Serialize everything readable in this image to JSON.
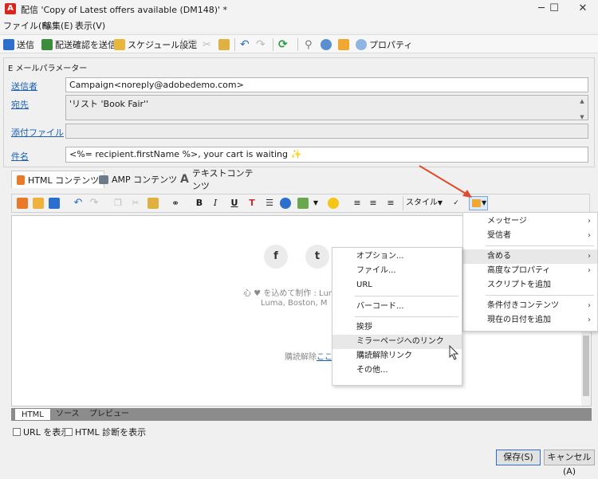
{
  "window": {
    "icon": "A",
    "title": "配信 'Copy of Latest offers available (DM148)' *",
    "controls": [
      "─",
      "☐",
      "✕"
    ]
  },
  "menubar": [
    "ファイル(F)",
    "編集(E)",
    "表示(V)"
  ],
  "toolbar": {
    "send": "送信",
    "send_proof": "配送確認を送信",
    "schedule": "スケジュール設定",
    "properties": "プロパティ"
  },
  "email_params": {
    "section_title": "E メールパラメーター",
    "from_label": "送信者",
    "from_value": "Campaign<noreply@adobedemo.com>",
    "to_label": "宛先",
    "to_value": "'リスト 'Book Fair''",
    "attachment_label": "添付ファイル",
    "attachment_value": "",
    "subject_label": "件名",
    "subject_value": "<%= recipient.firstName %>, your cart is waiting ✨"
  },
  "content_tabs": [
    "HTML コンテンツ",
    "AMP コンテンツ",
    "テキストコンテンツ"
  ],
  "editor_toolbar": {
    "bold": "B",
    "italic": "I",
    "underline": "U",
    "style": "スタイル"
  },
  "editor_preview": {
    "facebook": "f",
    "twitter": "t",
    "made_with": "心 ♥ を込めて制作 : Lum",
    "address": "Luma, Boston, M",
    "unsubscribe_prefix": "購読解除",
    "unsubscribe_link": "ここ"
  },
  "bottom_tabs": [
    "HTML",
    "ソース",
    "プレビュー"
  ],
  "checkboxes": [
    "URL を表示",
    "HTML 診断を表示"
  ],
  "buttons": {
    "save": "保存(S)",
    "cancel": "キャンセル(A)"
  },
  "menu_main": [
    "メッセージ",
    "受信者",
    "含める",
    "高度なプロパティ",
    "スクリプトを追加",
    "条件付きコンテンツ",
    "現在の日付を追加"
  ],
  "menu_include": [
    "オプション...",
    "ファイル...",
    "URL",
    "バーコード...",
    "挨拶",
    "ミラーページへのリンク",
    "購読解除リンク",
    "その他..."
  ],
  "colors": {
    "accent_red": "#d9261c",
    "link_blue": "#1a5fb4",
    "arrow_red": "#e04b2d"
  }
}
